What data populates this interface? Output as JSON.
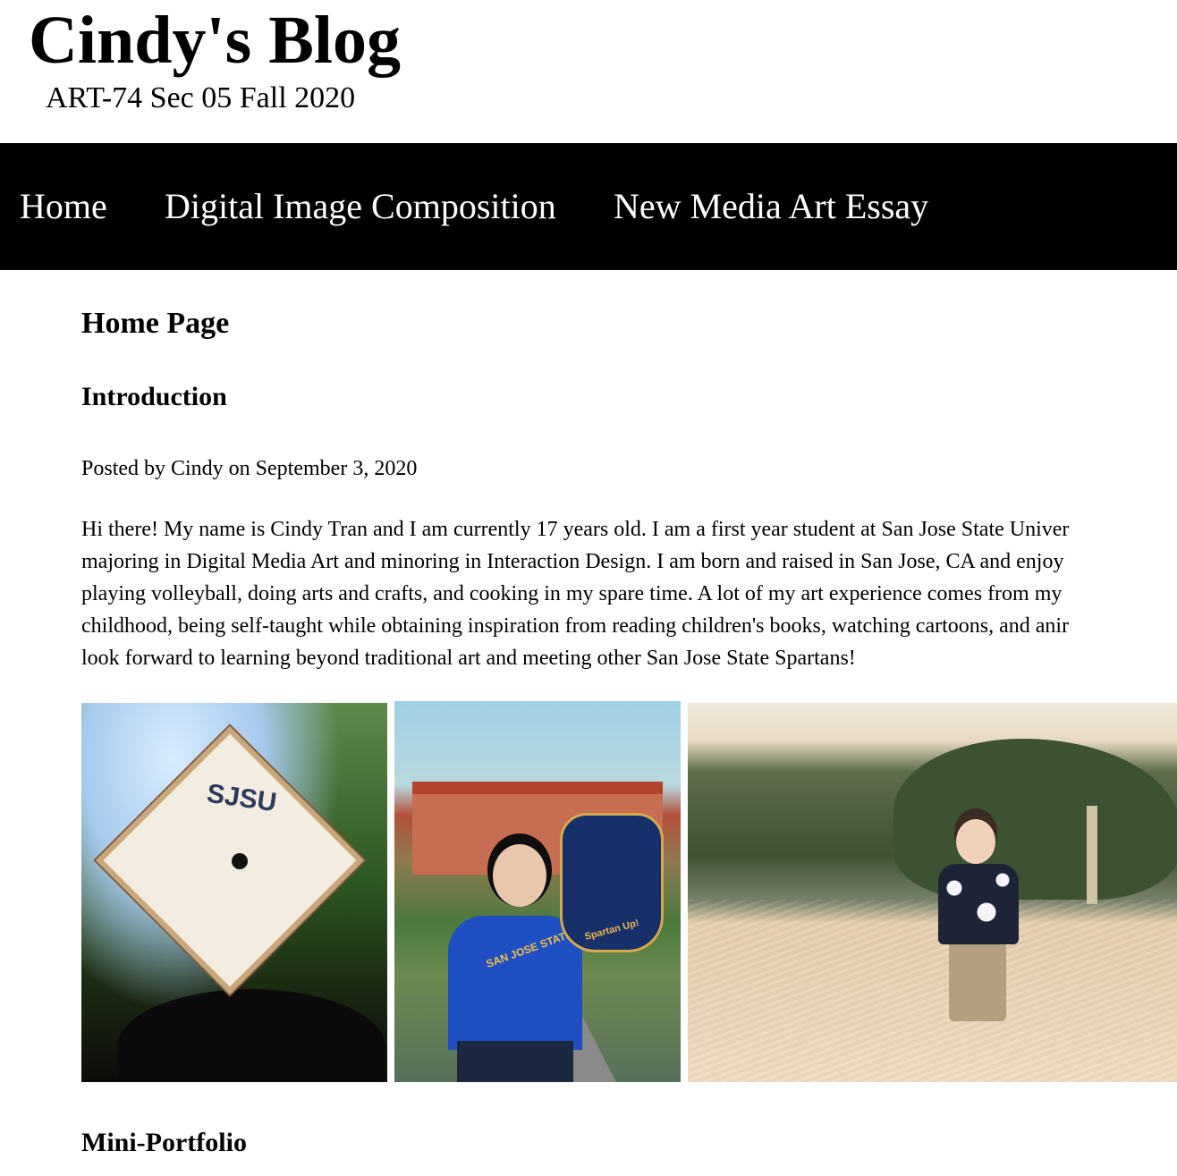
{
  "header": {
    "title": "Cindy's Blog",
    "subtitle": "ART-74 Sec 05 Fall 2020"
  },
  "nav": {
    "items": [
      {
        "label": "Home"
      },
      {
        "label": "Digital Image Composition"
      },
      {
        "label": "New Media Art Essay"
      }
    ]
  },
  "main": {
    "page_heading": "Home Page",
    "post": {
      "title": "Introduction",
      "meta": "Posted by Cindy on September 3, 2020",
      "body_lines": [
        "Hi there! My name is Cindy Tran and I am currently 17 years old. I am a first year student at San Jose State Univer",
        "majoring in Digital Media Art and minoring in Interaction Design. I am born and raised in San Jose, CA and enjoy",
        "playing volleyball, doing arts and crafts, and cooking in my spare time. A lot of my art experience comes from my",
        "childhood, being self-taught while obtaining inspiration from reading children's books, watching cartoons, and anir",
        "look forward to learning beyond traditional art and meeting other San Jose State Spartans!"
      ]
    },
    "photos": {
      "cap_text": "SJSU",
      "shirt_text": "SAN JOSE STATE",
      "foam_text": "Spartan Up!"
    },
    "section_heading": "Mini-Portfolio"
  }
}
